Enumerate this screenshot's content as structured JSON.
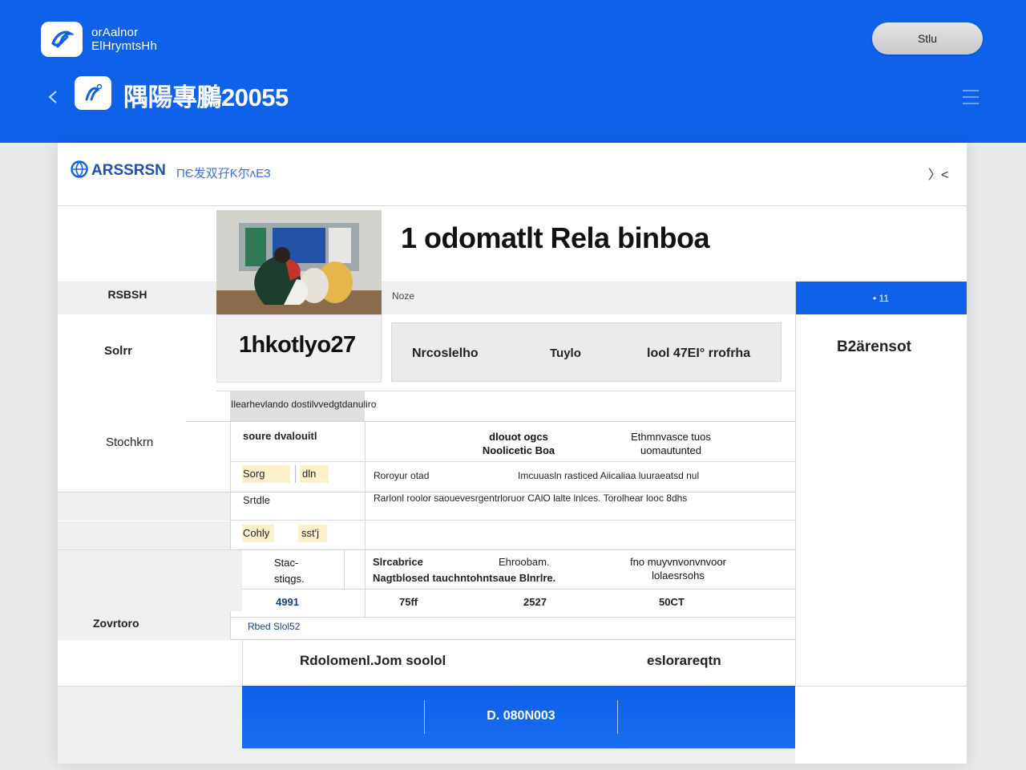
{
  "header": {
    "brand_line1": "orAalnor",
    "brand_line2": "ElHrymtsHh",
    "pill_label": "Stlu",
    "title": "隅陽專鵩20055"
  },
  "panel": {
    "brand": "ARSSRSN",
    "brand_sub": "ПЄ发双孖Ƙ尔ᴧЕЗ",
    "close_glyph": "〉<",
    "headline": "1 odomatlt Rela binboa",
    "row_label_1": "RSBSH",
    "strip_label": "Noze",
    "blue_tab_label": "• 11",
    "row_label_2": "Solrr",
    "code": "1hkotlyo27",
    "info_bar": [
      "Nrcoslelho",
      "Tuylo",
      "lool 47EI° rrofrha"
    ],
    "right_badge": "B2ärensot",
    "caption": "Ilearhevlando dostilvvedgtdanuliro",
    "row_label_3": "Stochkrn",
    "row_label_4": "Zovrtoro",
    "section1": {
      "left_header": "soure dvalouitl",
      "col_a": [
        "dlouot ogcs",
        "Noolicetic Boa"
      ],
      "col_b": [
        "Ethmnvasce tuos",
        "uomautunted"
      ],
      "cells": [
        "Sorg",
        "dln"
      ],
      "row_text_1": "Roroyur otad",
      "row_text_1b": "Imcuuasln rasticed Aiicaliaa luuraeatsd nul",
      "row_label_b": "Srtdle",
      "row_text_2": "Rarlonl roolor saouevesrgentrloruor CAlO lalte lnlces. Torolhear looc 8dhs",
      "cells2": [
        "Cohly",
        "sst'j"
      ]
    },
    "section2": {
      "left": [
        "Stac-",
        "stiqgs."
      ],
      "col1": "Slrcabrice",
      "col1b": "Nagtblosed tauchntohntsaue Blnrlre.",
      "col2": "Ehroobam.",
      "col3": [
        "fno muyvnvonvnvoor",
        "lolaesrsohs"
      ],
      "values": [
        "4991",
        "75ff",
        "2527",
        "50CT"
      ],
      "footnote": "Rbed Slol52"
    },
    "summary_left": "Rdolomenl.Jom soolol",
    "summary_right": "eslorareqtn",
    "footer_label": "D. 080N003"
  },
  "colors": {
    "accent": "#0e62ea",
    "panel_bg": "#ffffff",
    "grey_band": "#efeff1"
  },
  "icons": {
    "brand_logo": "bird-swoosh-icon",
    "back": "chevron-left-icon",
    "menu": "hamburger-icon",
    "panel_logo": "globe-icon"
  }
}
